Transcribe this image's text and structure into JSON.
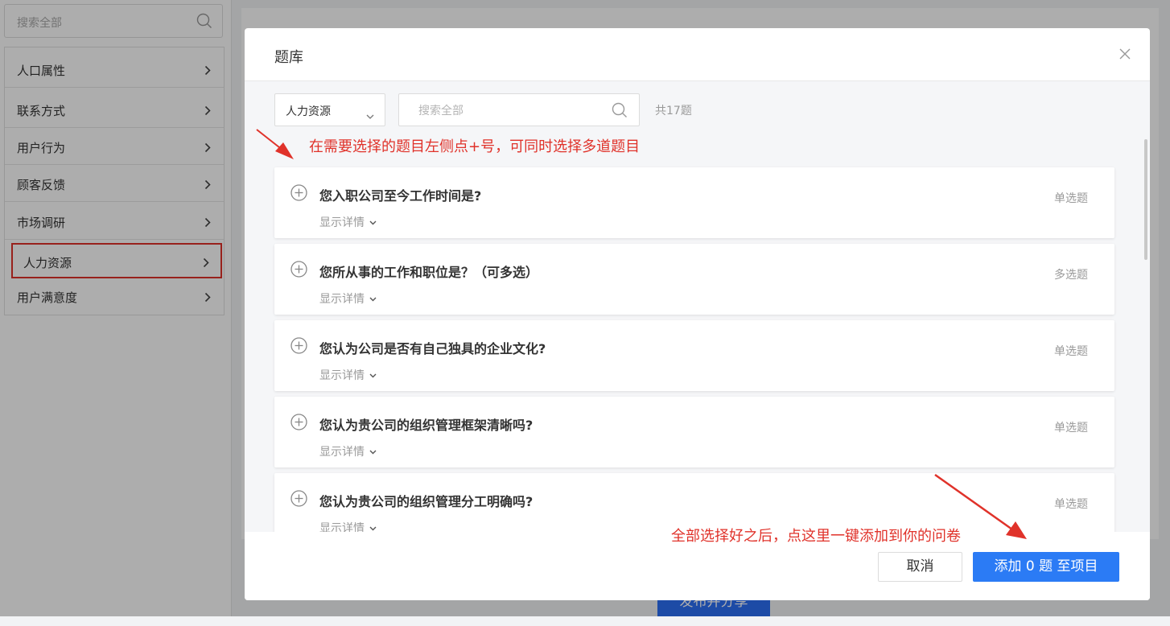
{
  "sidebar": {
    "search_placeholder": "搜索全部",
    "items": [
      {
        "label": "人口属性"
      },
      {
        "label": "联系方式"
      },
      {
        "label": "用户行为"
      },
      {
        "label": "顾客反馈"
      },
      {
        "label": "市场调研"
      },
      {
        "label": "人力资源",
        "selected": true
      },
      {
        "label": "用户满意度"
      }
    ]
  },
  "background": {
    "publish_label": "发布并分享"
  },
  "modal": {
    "title": "题库",
    "category_select": "人力资源",
    "search_placeholder": "搜索全部",
    "total": "共17题",
    "detail_label": "显示详情",
    "questions": [
      {
        "title": "您入职公司至今工作时间是?",
        "type": "单选题"
      },
      {
        "title": "您所从事的工作和职位是？（可多选）",
        "type": "多选题"
      },
      {
        "title": "您认为公司是否有自己独具的企业文化?",
        "type": "单选题"
      },
      {
        "title": "您认为贵公司的组织管理框架清晰吗?",
        "type": "单选题"
      },
      {
        "title": "您认为贵公司的组织管理分工明确吗?",
        "type": "单选题"
      }
    ],
    "cancel_label": "取消",
    "add_label": "添加 0 题 至项目"
  },
  "annotations": {
    "top": "在需要选择的题目左侧点+号，可同时选择多道题目",
    "bottom": "全部选择好之后，点这里一键添加到你的问卷"
  },
  "colors": {
    "accent": "#2b7bf5",
    "annotation": "#e0322a",
    "selected_border": "#e0322a"
  }
}
